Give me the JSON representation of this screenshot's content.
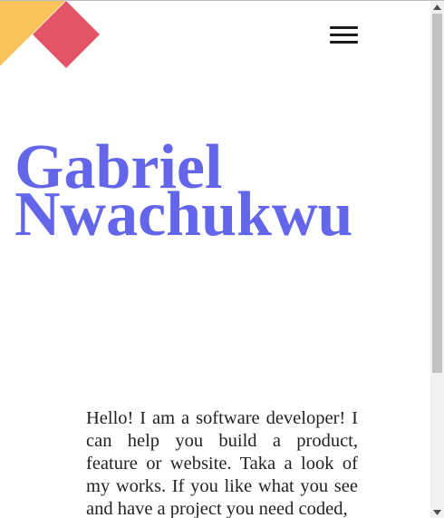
{
  "header": {
    "logo_colors": [
      "#fcc25b",
      "#e35467"
    ],
    "menu_icon": "hamburger-icon"
  },
  "hero": {
    "first_name": "Gabriel",
    "last_name": "Nwachukwu",
    "color": "#6366ea"
  },
  "intro": {
    "text": "Hello! I am a software developer! I can help you build a product, feature or website. Taka a look of my works. If you like what you see and have a project you need coded,"
  },
  "scrollbar": {
    "up_icon": "arrow-up-icon",
    "down_icon": "arrow-down-icon"
  }
}
